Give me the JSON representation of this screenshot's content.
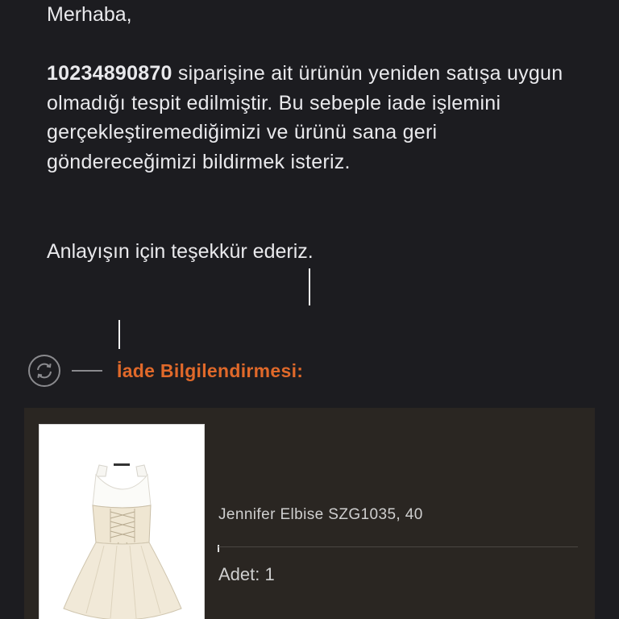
{
  "email": {
    "greeting": "Merhaba,",
    "order_number": "10234890870",
    "message_rest": " siparişine ait ürünün yeniden satışa uygun olmadığı tespit edilmiştir. Bu sebeple iade işlemini gerçekleştiremediğimizi ve ürünü sana geri göndereceğimizi bildirmek isteriz.",
    "thanks": "Anlayışın için teşekkür ederiz."
  },
  "return_info": {
    "icon": "refresh-icon",
    "title": "İade Bilgilendirmesi:",
    "accent_color": "#e0692a"
  },
  "product": {
    "image": "dress-product-image",
    "name": "Jennifer Elbise SZG1035, 40",
    "quantity": "Adet: 1"
  }
}
